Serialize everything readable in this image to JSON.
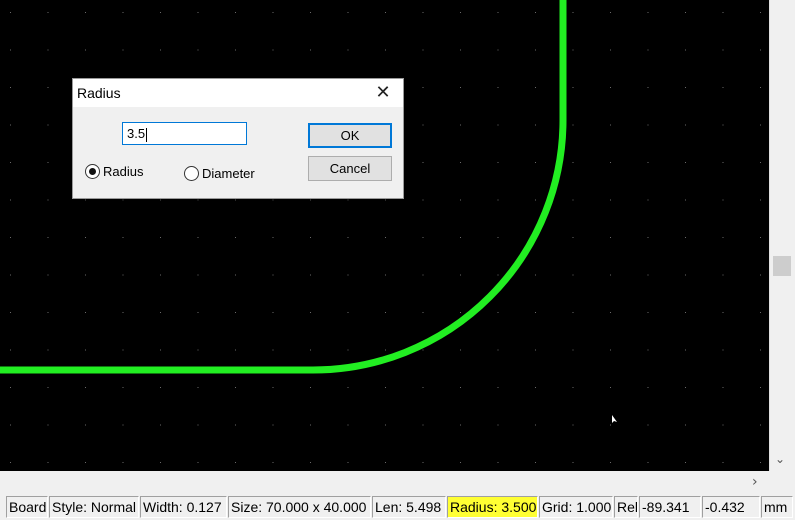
{
  "dialog": {
    "title": "Radius",
    "input_value": "3.5",
    "ok_label": "OK",
    "cancel_label": "Cancel",
    "options": [
      {
        "label": "Radius",
        "selected": true
      },
      {
        "label": "Diameter",
        "selected": false
      }
    ]
  },
  "statusbar": {
    "cells": [
      "Board",
      "Style: Normal",
      "Width: 0.127",
      "Size: 70.000 x 40.000",
      "Len: 5.498",
      "Radius: 3.500",
      "Grid: 1.000",
      "Rel",
      "-89.341",
      "-0.432",
      "mm"
    ],
    "highlight_color": "#ffff33"
  },
  "canvas": {
    "background": "#000000",
    "trace_color": "#22ee22"
  },
  "icons": {
    "close": "close-icon",
    "scroll_down": "chevron-down-icon",
    "scroll_right": "chevron-right-icon"
  }
}
